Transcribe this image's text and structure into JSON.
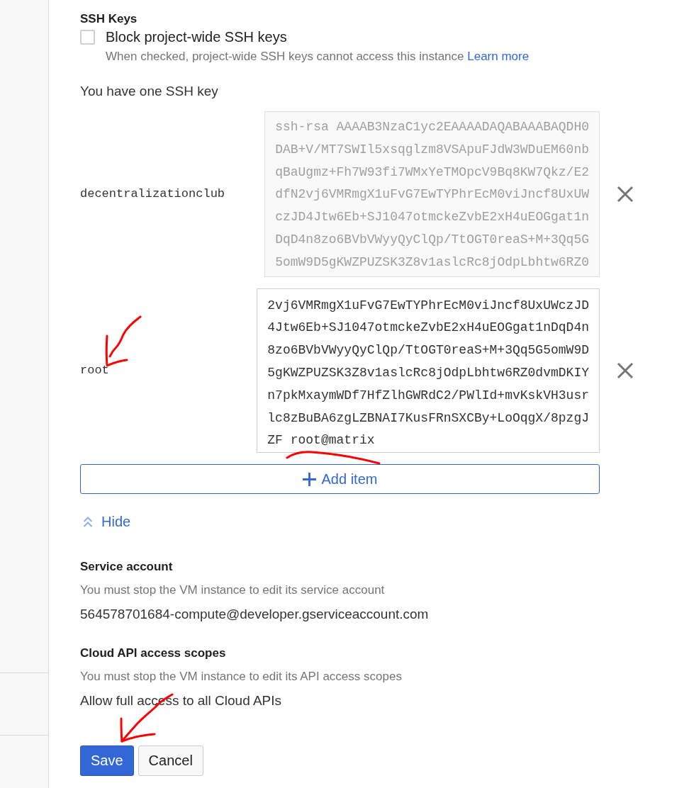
{
  "ssh_keys": {
    "title": "SSH Keys",
    "block_project_keys": {
      "label": "Block project-wide SSH keys",
      "checked": false,
      "hint": "When checked, project-wide SSH keys cannot access this instance",
      "link": "Learn more"
    },
    "summary": "You have one SSH key",
    "keys": [
      {
        "username": "decentralizationclub",
        "readonly": true,
        "lines": [
          "ssh-rsa AAAAB3NzaC1yc2EAAAADAQABAAABAQDH0",
          "DAB+V/MT7SWIl5xsqglzm8VSApuFJdW3WDuEM60nb",
          "qBaUgmz+Fh7W93fi7WMxYeTMOpcV9Bq8KW7Qkz/E2",
          "dfN2vj6VMRmgX1uFvG7EwTYPhrEcM0viJncf8UxUW",
          "czJD4Jtw6Eb+SJ1047otmckeZvbE2xH4uEOGgat1n",
          "DqD4n8zo6BVbVWyyQyClQp/TtOGT0reaS+M+3Qq5G",
          "5omW9D5gKWZPUZSK3Z8v1aslcRc8jOdpLbhtw6RZ0"
        ]
      },
      {
        "username": "root",
        "readonly": false,
        "lines": [
          "2vj6VMRmgX1uFvG7EwTYPhrEcM0viJncf8UxUWczJD",
          "4Jtw6Eb+SJ1047otmckeZvbE2xH4uEOGgat1nDqD4n",
          "8zo6BVbVWyyQyClQp/TtOGT0reaS+M+3Qq5G5omW9D",
          "5gKWZPUZSK3Z8v1aslcRc8jOdpLbhtw6RZ0dvmDKIY",
          "n7pkMxaymWDf7HfZlhGWRdC2/PWlId+mvKskVH3usr",
          "lc8zBuBA6zgLZBNAI7KusFRnSXCBy+LoOqgX/8pzgJ",
          "ZF root@matrix"
        ]
      }
    ],
    "add_button": "Add item",
    "toggle": {
      "label": "Hide",
      "expanded": true
    }
  },
  "service_account": {
    "title": "Service account",
    "hint": "You must stop the VM instance to edit its service account",
    "value": "564578701684-compute@developer.gserviceaccount.com"
  },
  "api_scopes": {
    "title": "Cloud API access scopes",
    "hint": "You must stop the VM instance to edit its API access scopes",
    "value": "Allow full access to all Cloud APIs"
  },
  "buttons": [
    {
      "label": "Save",
      "kind": "primary"
    },
    {
      "label": "Cancel",
      "kind": "secondary"
    }
  ]
}
